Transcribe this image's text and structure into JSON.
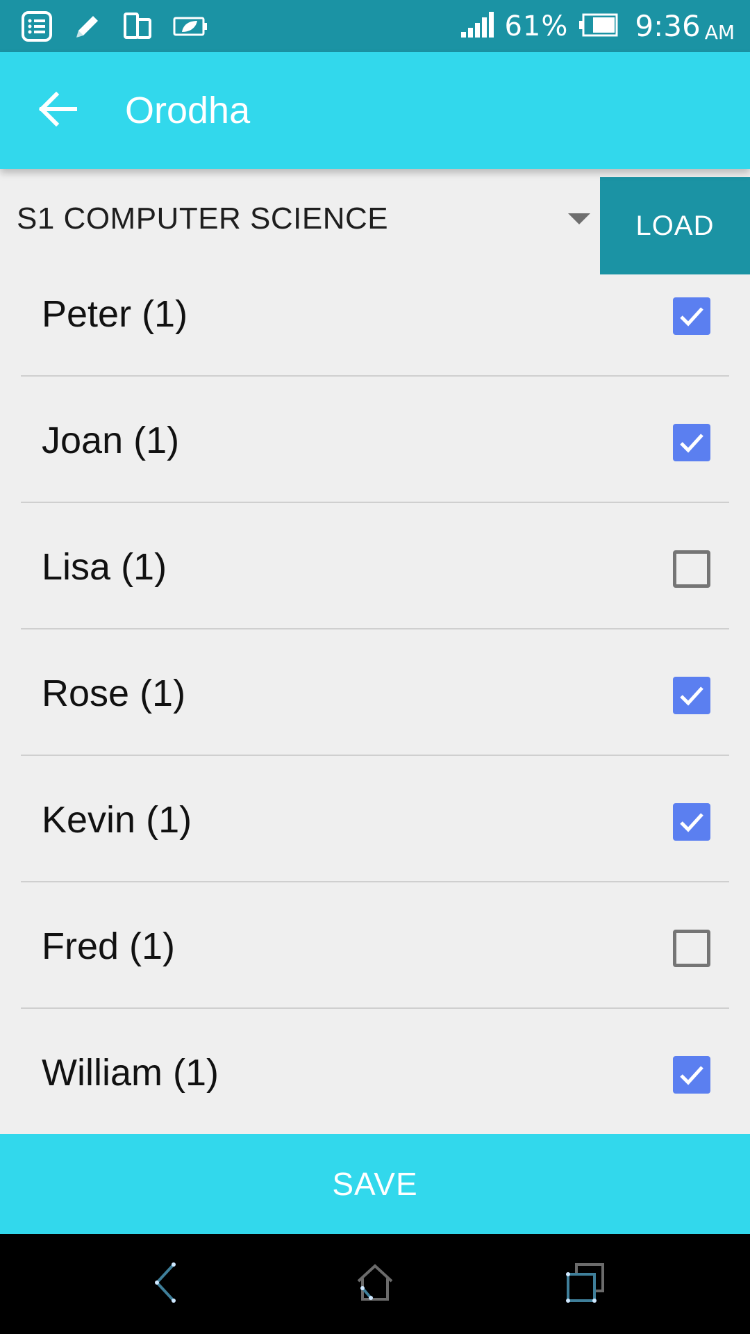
{
  "status_bar": {
    "icons": [
      "list-icon",
      "pencil-icon",
      "device-rotate-icon",
      "battery-saver-icon",
      "signal-icon",
      "battery-icon"
    ],
    "battery_percent": "61%",
    "time": "9:36",
    "ampm": "AM"
  },
  "app_bar": {
    "back_icon": "arrow-left-icon",
    "title": "Orodha"
  },
  "class_selector": {
    "selected": "S1 COMPUTER SCIENCE",
    "load_label": "LOAD"
  },
  "students": [
    {
      "name": "Peter (1)",
      "checked": true
    },
    {
      "name": "Joan (1)",
      "checked": true
    },
    {
      "name": "Lisa (1)",
      "checked": false
    },
    {
      "name": "Rose (1)",
      "checked": true
    },
    {
      "name": "Kevin (1)",
      "checked": true
    },
    {
      "name": "Fred (1)",
      "checked": false
    },
    {
      "name": "William (1)",
      "checked": true
    }
  ],
  "save_label": "SAVE",
  "nav_bar": {
    "icons": [
      "back-nav-icon",
      "home-nav-icon",
      "recents-nav-icon"
    ]
  },
  "colors": {
    "status_bar": "#1b93a4",
    "app_bar": "#32d8ec",
    "load_button": "#1b93a4",
    "checkbox_checked": "#5b7ff0",
    "background": "#efefef"
  }
}
